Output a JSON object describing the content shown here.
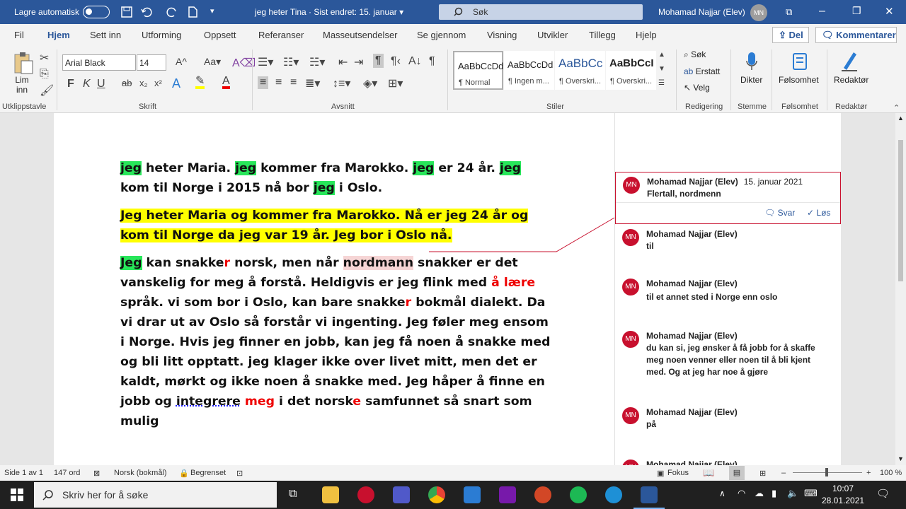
{
  "titlebar": {
    "autosave": "Lagre automatisk",
    "doc_title": "jeg heter Tina  ·  Sist endret: 15. januar  ▾",
    "search": "Søk",
    "user": "Mohamad Najjar (Elev)",
    "initials": "MN"
  },
  "tabs": [
    "Fil",
    "Hjem",
    "Sett inn",
    "Utforming",
    "Oppsett",
    "Referanser",
    "Masseutsendelser",
    "Se gjennom",
    "Visning",
    "Utvikler",
    "Tillegg",
    "Hjelp"
  ],
  "share": "Del",
  "comments_btn": "Kommentarer",
  "ribbon": {
    "paste": "Lim inn",
    "font": "Arial Black",
    "size": "14",
    "styles": [
      {
        "preview": "AaBbCcDd",
        "name": "¶ Normal"
      },
      {
        "preview": "AaBbCcDd",
        "name": "¶ Ingen m..."
      },
      {
        "preview": "AaBbCc",
        "name": "¶ Overskri..."
      },
      {
        "preview": "AaBbCcI",
        "name": "¶ Overskri..."
      }
    ],
    "find": "Søk",
    "replace": "Erstatt",
    "select": "Velg",
    "dictate": "Dikter",
    "sensitivity": "Følsomhet",
    "editor": "Redaktør",
    "groups": [
      "Utklippstavle",
      "Skrift",
      "Avsnitt",
      "Stiler",
      "Redigering",
      "Stemme",
      "Følsomhet",
      "Redaktør"
    ]
  },
  "doc": {
    "p1": [
      [
        "jeg",
        "g"
      ],
      [
        " heter Maria. ",
        ""
      ],
      [
        "jeg",
        "g"
      ],
      [
        " kommer fra Marokko. ",
        ""
      ],
      [
        "jeg",
        "g"
      ],
      [
        " er 24 år. ",
        ""
      ],
      [
        "jeg",
        "g"
      ],
      [
        " kom til Norge i 2015 nå bor ",
        ""
      ],
      [
        "jeg",
        "g"
      ],
      [
        " i Oslo.",
        ""
      ]
    ],
    "p2": [
      [
        "Jeg heter Maria og kommer fra Marokko. Nå er jeg 24 år og kom til Norge da jeg var 19 år. Jeg bor i Oslo nå.",
        "y"
      ]
    ],
    "p3": [
      [
        "Jeg",
        "g"
      ],
      [
        " kan snakke",
        ""
      ],
      [
        "r",
        "r"
      ],
      [
        " norsk, men når ",
        ""
      ],
      [
        "nordmann",
        "pink"
      ],
      [
        " snakker er det vanskelig for meg å forstå. Heldigvis er jeg flink med ",
        ""
      ],
      [
        "å lære",
        "r"
      ],
      [
        " språk. vi som bor i Oslo, kan bare snakke",
        ""
      ],
      [
        "r",
        "r"
      ],
      [
        " bokmål dialekt. Da vi drar ut av Oslo så forstår vi ingenting. Jeg føler meg ensom i Norge. Hvis jeg finner en jobb, kan jeg få noen å snakke med og bli litt opptatt. jeg klager ikke over livet mitt, men det er kaldt, mørkt og ikke noen å snakke med. Jeg håper å finne en jobb og ",
        ""
      ],
      [
        "integrere",
        "dotul"
      ],
      [
        " ",
        ""
      ],
      [
        "meg",
        "r"
      ],
      [
        " i det norsk",
        ""
      ],
      [
        "e",
        "r"
      ],
      [
        " samfunnet så snart som mulig",
        ""
      ]
    ]
  },
  "comments": [
    {
      "author": "Mohamad Najjar (Elev)",
      "date": "15. januar 2021",
      "body": "Flertall, nordmenn",
      "reply": "Svar",
      "resolve": "Løs"
    },
    {
      "author": "Mohamad Najjar (Elev)",
      "body": "til"
    },
    {
      "author": "Mohamad Najjar (Elev)",
      "body": "til et annet sted i Norge enn oslo"
    },
    {
      "author": "Mohamad Najjar (Elev)",
      "body": "du kan si, jeg ønsker å få jobb for å skaffe meg noen venner eller noen til å bli kjent med. Og at jeg har noe å gjøre"
    },
    {
      "author": "Mohamad Najjar (Elev)",
      "body": "på"
    },
    {
      "author": "Mohamad Najjar (Elev)",
      "body": ""
    }
  ],
  "status": {
    "page": "Side 1 av 1",
    "words": "147 ord",
    "lang": "Norsk (bokmål)",
    "restrict": "Begrenset",
    "focus": "Fokus",
    "zoom": "100 %"
  },
  "taskbar": {
    "search": "Skriv her for å søke",
    "time": "10:07",
    "date": "28.01.2021"
  }
}
